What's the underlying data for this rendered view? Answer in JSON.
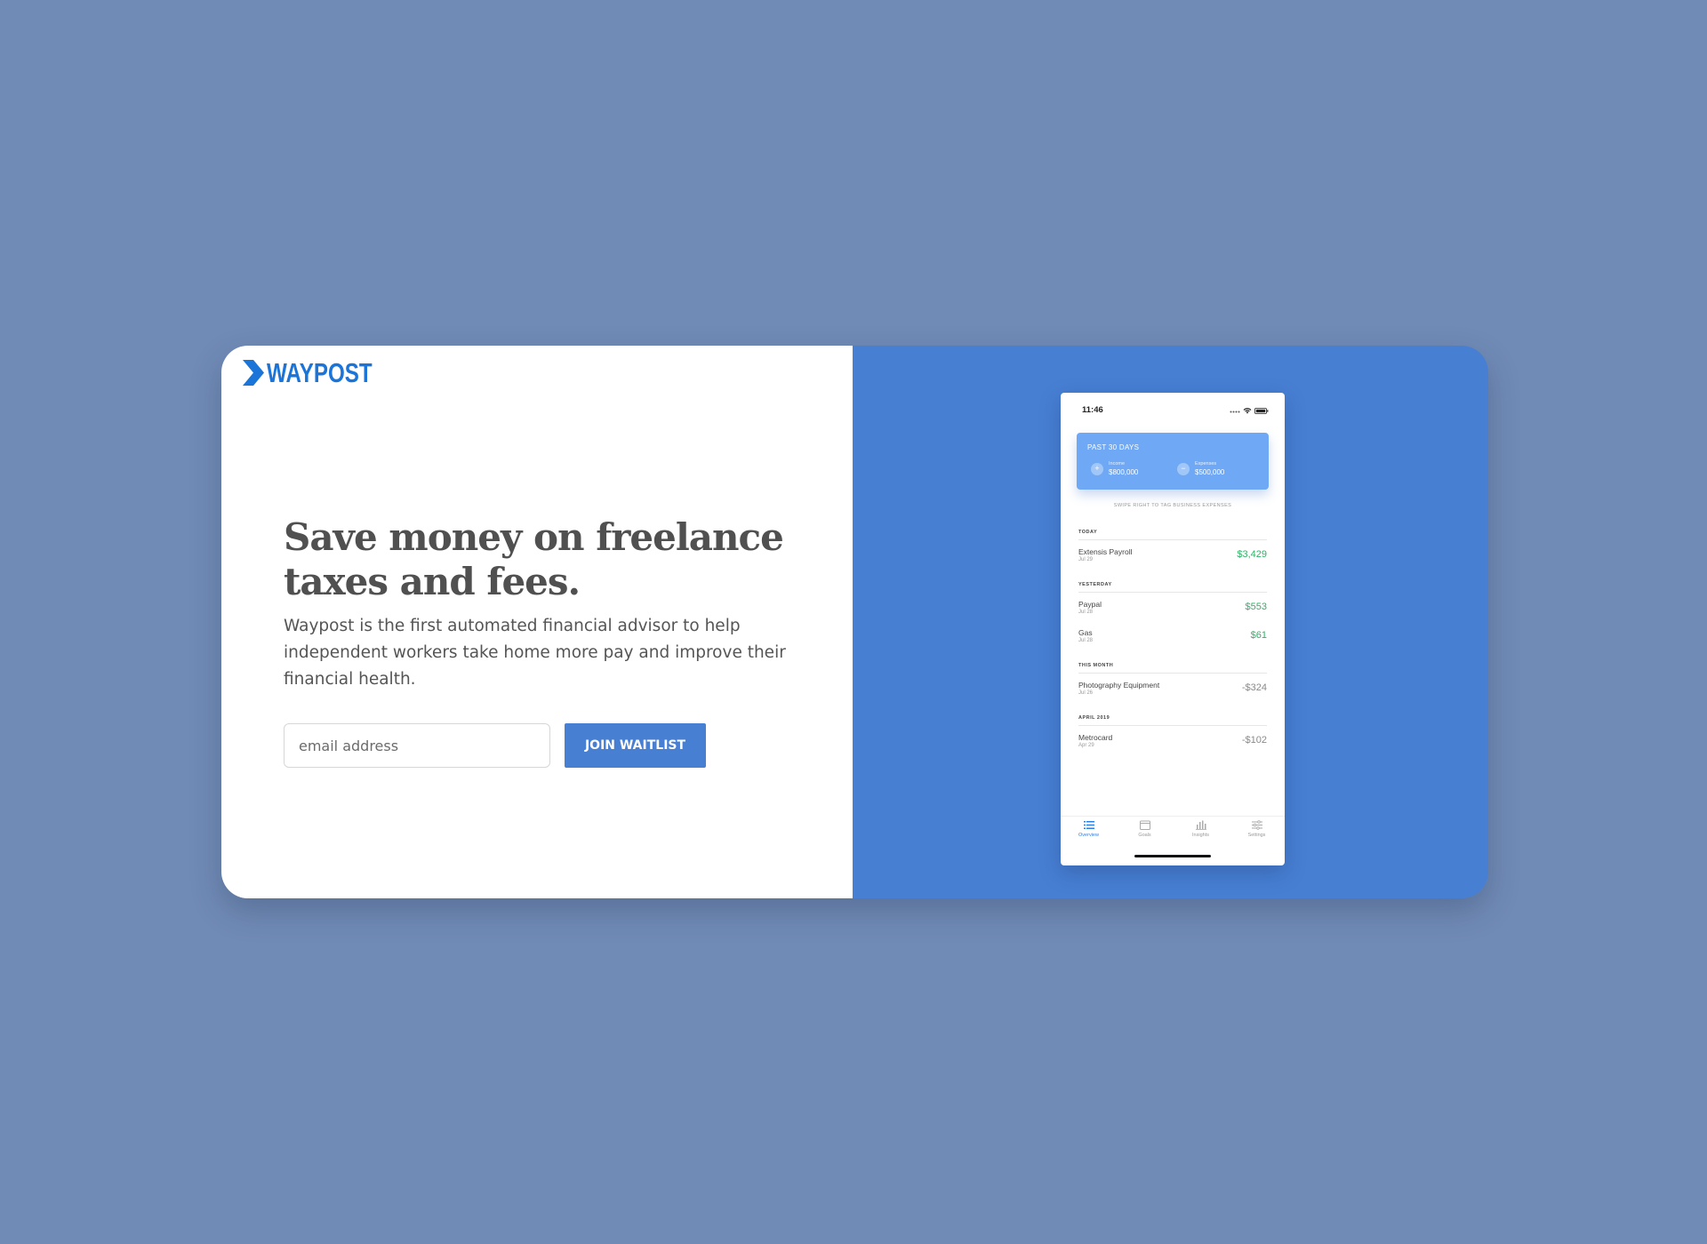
{
  "brand": {
    "name": "WAYPOST",
    "color": "#1b74d8"
  },
  "hero": {
    "headline": "Save money on freelance taxes and fees.",
    "description": "Waypost is the first automated financial advisor to help independent workers take home more pay and improve their financial health."
  },
  "form": {
    "email_placeholder": "email address",
    "submit_label": "JOIN WAITLIST"
  },
  "phone": {
    "time": "11:46",
    "summary": {
      "title": "PAST 30 DAYS",
      "income_icon": "plus-icon",
      "income_label": "Income",
      "income_value": "$800,000",
      "expense_icon": "minus-icon",
      "expense_label": "Expenses",
      "expense_value": "$500,000"
    },
    "hint": "SWIPE RIGHT TO TAG BUSINESS EXPENSES",
    "sections": [
      {
        "header": "TODAY",
        "items": [
          {
            "name": "Extensis Payroll",
            "date": "Jul 29",
            "amount": "$3,429"
          }
        ]
      },
      {
        "header": "YESTERDAY",
        "items": [
          {
            "name": "Paypal",
            "date": "Jul 28",
            "amount": "$553"
          },
          {
            "name": "Gas",
            "date": "Jul 28",
            "amount": "$61"
          }
        ]
      },
      {
        "header": "THIS MONTH",
        "items": [
          {
            "name": "Photography Equipment",
            "date": "Jul 26",
            "amount": "-$324"
          }
        ]
      },
      {
        "header": "APRIL 2019",
        "items": [
          {
            "name": "Metrocard",
            "date": "Apr 29",
            "amount": "-$102"
          }
        ]
      }
    ],
    "tabs": [
      {
        "label": "Overview",
        "icon": "list-icon",
        "active": true
      },
      {
        "label": "Goals",
        "icon": "calendar-icon",
        "active": false
      },
      {
        "label": "Insights",
        "icon": "bar-chart-icon",
        "active": false
      },
      {
        "label": "Settings",
        "icon": "sliders-icon",
        "active": false
      }
    ]
  },
  "colors": {
    "page_bg": "#708bb6",
    "panel_blue": "#477fd3",
    "positive": "#2fb266",
    "negative": "#8a8a8a",
    "summary_card": "#6fa8f5"
  }
}
